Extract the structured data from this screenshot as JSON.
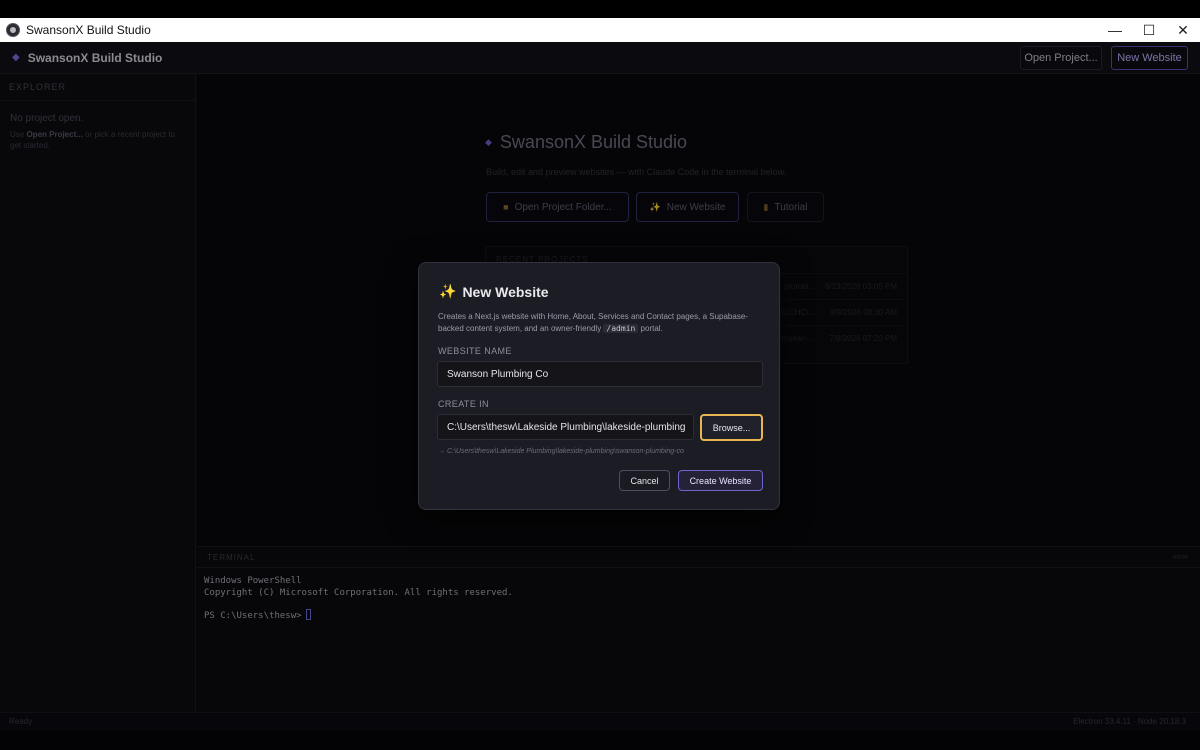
{
  "window": {
    "title": "SwansonX Build Studio",
    "controls": {
      "minimize": "—",
      "maximize": "☐",
      "close": "✕"
    }
  },
  "header": {
    "brand": "SwansonX Build Studio",
    "open_project_label": "Open Project...",
    "new_website_label": "New Website"
  },
  "sidebar": {
    "section_title": "EXPLORER",
    "empty_text": "No project open.",
    "hint_prefix": "Use ",
    "hint_link": "Open Project...",
    "hint_suffix": " or pick a recent project to get started."
  },
  "welcome": {
    "title": "SwansonX Build Studio",
    "subtitle": "Build, edit and preview websites — with Claude Code in the terminal below.",
    "open_folder_label": "Open Project Folder...",
    "new_website_label": "New Website",
    "tutorial_label": "Tutorial",
    "recent_title": "RECENT PROJECTS",
    "recent": [
      {
        "path": "plumbi...",
        "date": "8/23/2026 03:05 PM"
      },
      {
        "path": "n\\UCHC\\...",
        "date": "8/9/2026 08:30 AM"
      },
      {
        "path": "n\\sean-...",
        "date": "7/8/2026 07:20 PM"
      }
    ]
  },
  "terminal": {
    "title": "TERMINAL",
    "shell": "none",
    "lines": [
      "Windows PowerShell",
      "Copyright (C) Microsoft Corporation. All rights reserved."
    ],
    "prompt": "PS C:\\Users\\thesw>"
  },
  "statusbar": {
    "left": "Ready",
    "right": "Electron 33.4.11 · Node 20.18.3"
  },
  "modal": {
    "title": "New Website",
    "desc_a": "Creates a Next.js website with Home, About, Services and Contact pages, a Supabase-backed content system, and an owner-friendly ",
    "desc_code": "/admin",
    "desc_b": " portal.",
    "name_label": "WEBSITE NAME",
    "name_value": "Swanson Plumbing Co",
    "create_in_label": "CREATE IN",
    "create_in_value": "C:\\Users\\thesw\\Lakeside Plumbing\\lakeside-plumbing",
    "browse_label": "Browse...",
    "target_path": "→ C:\\Users\\thesw\\Lakeside Plumbing\\lakeside-plumbing\\swanson-plumbing-co",
    "cancel_label": "Cancel",
    "create_label": "Create Website"
  },
  "colors": {
    "accent": "#6f63d0",
    "focus_ring": "#e8b650",
    "background": "#0b0b10",
    "modal_bg": "#1c1c24"
  },
  "icons": {
    "app": "app-icon",
    "brand": "diamond-icon",
    "folder": "folder-icon",
    "sparkles": "sparkles-icon",
    "tutorial": "book-icon"
  }
}
